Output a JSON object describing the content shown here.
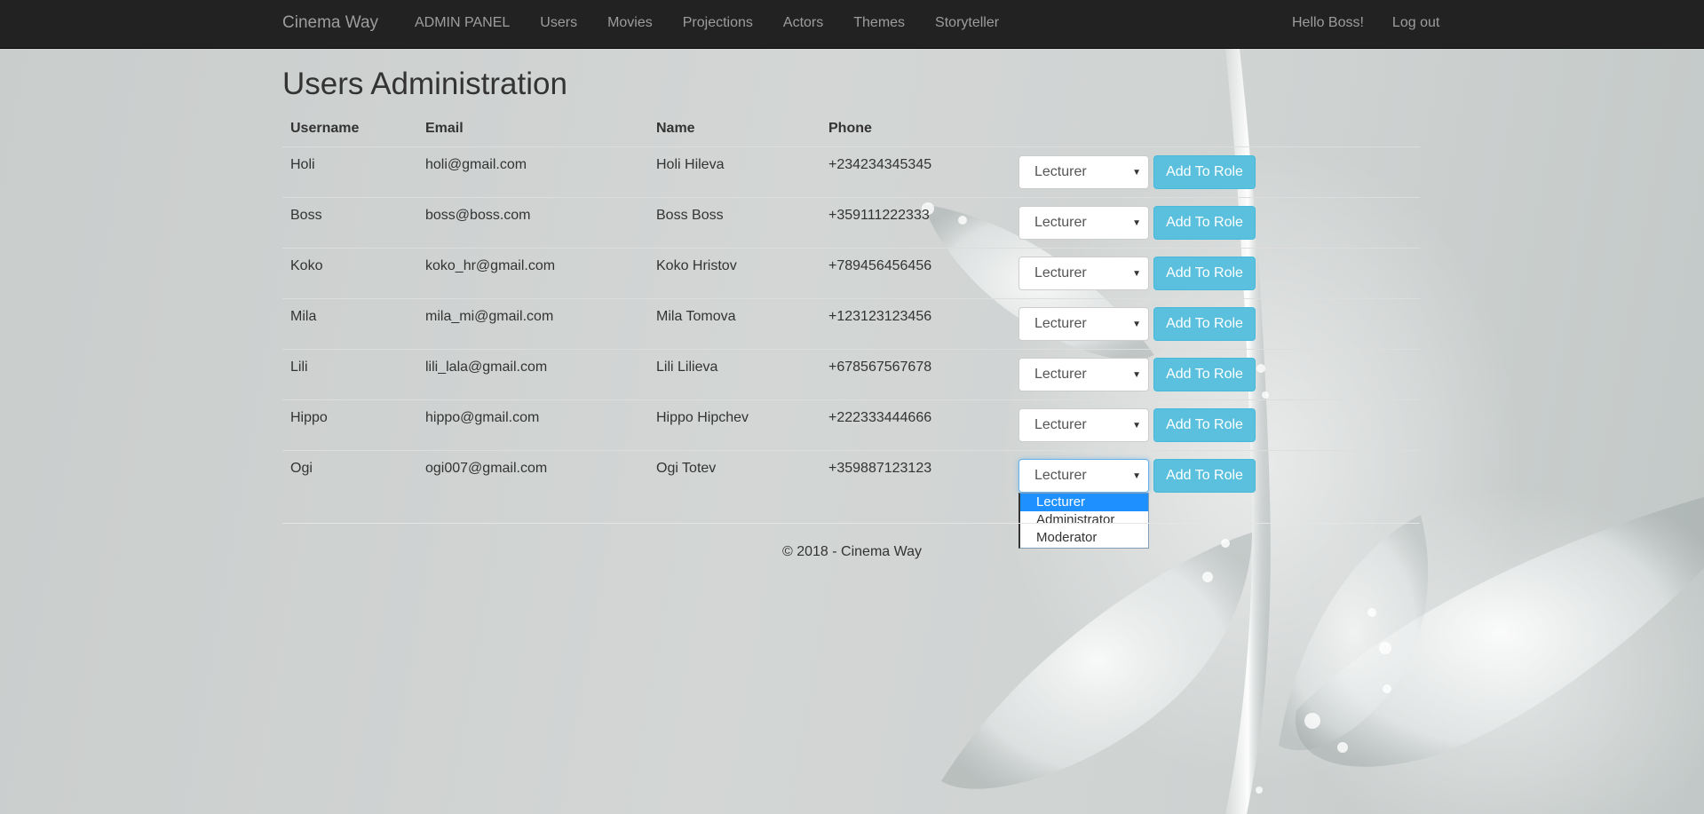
{
  "navbar": {
    "brand": "Cinema Way",
    "items": [
      {
        "label": "ADMIN PANEL"
      },
      {
        "label": "Users"
      },
      {
        "label": "Movies"
      },
      {
        "label": "Projections"
      },
      {
        "label": "Actors"
      },
      {
        "label": "Themes"
      },
      {
        "label": "Storyteller"
      }
    ],
    "greeting": "Hello Boss!",
    "logout": "Log out"
  },
  "page": {
    "title": "Users Administration"
  },
  "table": {
    "headers": {
      "username": "Username",
      "email": "Email",
      "name": "Name",
      "phone": "Phone"
    },
    "button_label": "Add To Role",
    "rows": [
      {
        "username": "Holi",
        "email": "holi@gmail.com",
        "name": "Holi Hileva",
        "phone": "+234234345345",
        "role": "Lecturer"
      },
      {
        "username": "Boss",
        "email": "boss@boss.com",
        "name": "Boss Boss",
        "phone": "+359111222333",
        "role": "Lecturer"
      },
      {
        "username": "Koko",
        "email": "koko_hr@gmail.com",
        "name": "Koko Hristov",
        "phone": "+789456456456",
        "role": "Lecturer"
      },
      {
        "username": "Mila",
        "email": "mila_mi@gmail.com",
        "name": "Mila Tomova",
        "phone": "+123123123456",
        "role": "Lecturer"
      },
      {
        "username": "Lili",
        "email": "lili_lala@gmail.com",
        "name": "Lili Lilieva",
        "phone": "+678567567678",
        "role": "Lecturer"
      },
      {
        "username": "Hippo",
        "email": "hippo@gmail.com",
        "name": "Hippo Hipchev",
        "phone": "+222333444666",
        "role": "Lecturer"
      },
      {
        "username": "Ogi",
        "email": "ogi007@gmail.com",
        "name": "Ogi Totev",
        "phone": "+359887123123",
        "role": "Lecturer"
      }
    ]
  },
  "dropdown": {
    "options": [
      "Lecturer",
      "Administrator",
      "Moderator"
    ],
    "selected": "Lecturer"
  },
  "footer": {
    "text": "© 2018 - Cinema Way"
  },
  "colors": {
    "navbar_bg": "#222222",
    "button_info": "#5bc0de",
    "option_highlight": "#1e90ff"
  }
}
